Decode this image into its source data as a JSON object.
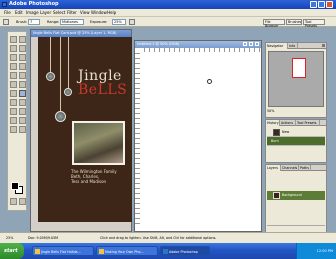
{
  "app": {
    "title": "Adobe Photoshop",
    "colors": {
      "titlebar": "#1643b8",
      "workspace": "#8fa4b6",
      "card_bg": "#3d2618",
      "selected_layer": "#5d7d36",
      "taskbar": "#2355c4"
    }
  },
  "menu": [
    "File",
    "Edit",
    "Image",
    "Layer",
    "Select",
    "Filter",
    "View",
    "Window",
    "Help"
  ],
  "options": {
    "brush_label": "Brush:",
    "brush_size": "7",
    "range_label": "Range:",
    "range_value": "Midtones",
    "exposure_label": "Exposure:",
    "exposure_value": "25%",
    "tabs": [
      "File Browser",
      "Brushes",
      "Tool Presets"
    ]
  },
  "doc1": {
    "title": "Jingle Bells Flat Card.psd @ 25% (Layer 1, RGB)"
  },
  "card": {
    "headline_1": "Jingle",
    "headline_2": "BeLLS",
    "caption_1": "The Wilmington Family",
    "caption_2": "Beth, Charles,",
    "caption_3": "Tess and Madison"
  },
  "doc2": {
    "title": "Untitled-1 @ 50% (RGB)"
  },
  "navigator": {
    "tabs": [
      "Navigator",
      "Info"
    ],
    "zoom": "50%"
  },
  "history": {
    "tabs": [
      "History",
      "Actions",
      "Tool Presets"
    ],
    "items": [
      "New",
      "Burn"
    ],
    "selected_index": 1
  },
  "layers": {
    "tabs": [
      "Layers",
      "Channels",
      "Paths"
    ],
    "items": [
      "Background"
    ],
    "selected_index": 0
  },
  "status": {
    "zoom": "25%",
    "doc": "Doc: 9.05M/9.05M",
    "hint": "Click and drag to lighten. Use Shift, Alt, and Ctrl for additional options."
  },
  "taskbar": {
    "start": "start",
    "buttons": [
      "Jingle Bells Flat Holida...",
      "Making Your Own Pho...",
      "Adobe Photoshop"
    ],
    "active_index": 2,
    "time": "12:00 PM"
  }
}
